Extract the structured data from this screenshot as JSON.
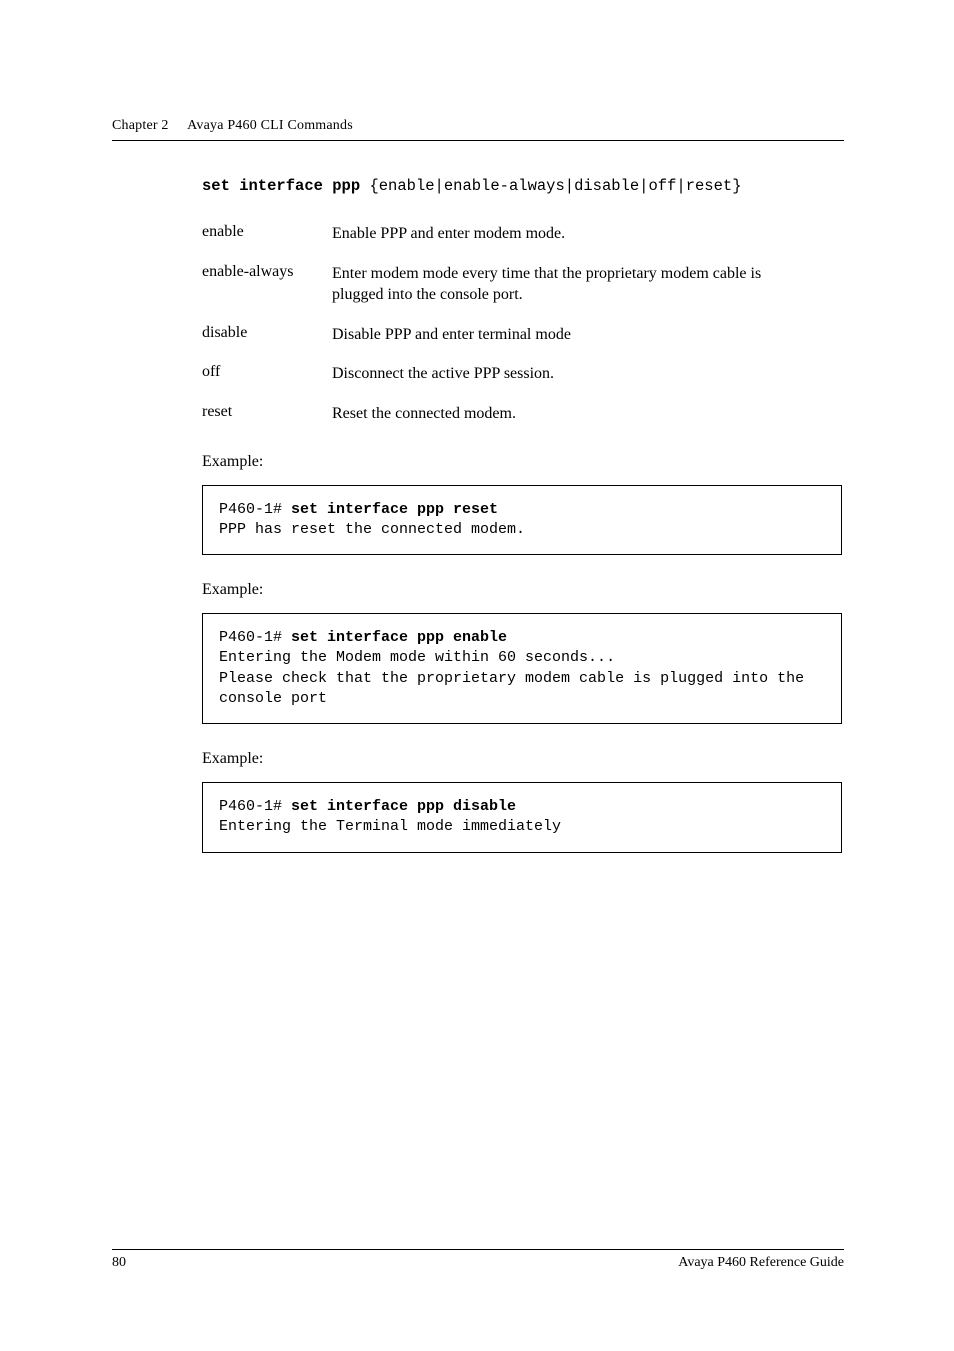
{
  "running_head": {
    "chapter": "Chapter 2",
    "title": "Avaya P460 CLI Commands"
  },
  "syntax": {
    "cmd_bold": "set interface ppp",
    "cmd_rest": " {enable|enable-always|disable|off|reset}"
  },
  "params": [
    {
      "name": "enable",
      "desc": "Enable PPP and enter modem mode."
    },
    {
      "name": "enable-always",
      "desc": "Enter modem mode every time that the proprietary modem cable is plugged into the console port."
    },
    {
      "name": "disable",
      "desc": "Disable PPP and enter terminal mode"
    },
    {
      "name": "off",
      "desc": "Disconnect the active PPP session."
    },
    {
      "name": "reset",
      "desc": "Reset the connected modem."
    }
  ],
  "examples": [
    {
      "label": "Example:",
      "lines": [
        {
          "prefix": "P460-1# ",
          "bold": "set interface ppp reset",
          "rest": ""
        },
        {
          "prefix": "",
          "bold": "",
          "rest": "PPP has reset the connected modem."
        }
      ]
    },
    {
      "label": "Example:",
      "lines": [
        {
          "prefix": "P460-1# ",
          "bold": "set interface ppp enable",
          "rest": ""
        },
        {
          "prefix": "",
          "bold": "",
          "rest": "Entering the Modem mode within 60 seconds..."
        },
        {
          "prefix": "",
          "bold": "",
          "rest": "Please check that the proprietary modem cable is plugged into the console port"
        }
      ]
    },
    {
      "label": "Example:",
      "lines": [
        {
          "prefix": "P460-1# ",
          "bold": "set interface ppp disable",
          "rest": ""
        },
        {
          "prefix": "",
          "bold": "",
          "rest": "Entering the Terminal mode immediately"
        }
      ]
    }
  ],
  "footer": {
    "page": "80",
    "doc": "Avaya P460 Reference Guide"
  }
}
